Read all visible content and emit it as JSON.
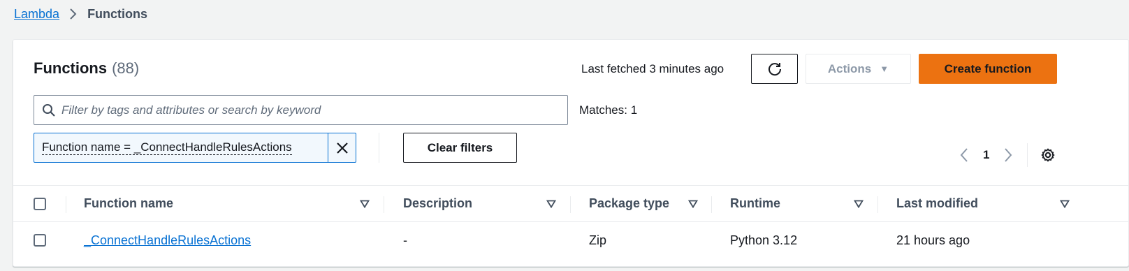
{
  "breadcrumb": {
    "root": "Lambda",
    "current": "Functions"
  },
  "panel": {
    "title": "Functions",
    "count": "(88)",
    "last_fetched": "Last fetched 3 minutes ago",
    "actions_label": "Actions",
    "create_label": "Create function"
  },
  "search": {
    "placeholder": "Filter by tags and attributes or search by keyword",
    "value": "",
    "matches": "Matches: 1"
  },
  "filter_token": {
    "label": "Function name = _ConnectHandleRulesActions"
  },
  "clear_filters_label": "Clear filters",
  "pagination": {
    "current_page": "1"
  },
  "table": {
    "columns": [
      "Function name",
      "Description",
      "Package type",
      "Runtime",
      "Last modified"
    ],
    "rows": [
      {
        "function_name": "_ConnectHandleRulesActions",
        "description": "-",
        "package_type": "Zip",
        "runtime": "Python 3.12",
        "last_modified": "21 hours ago"
      }
    ]
  },
  "colors": {
    "accent_link": "#0972d3",
    "primary_button": "#ec7211",
    "background": "#f2f3f3"
  }
}
